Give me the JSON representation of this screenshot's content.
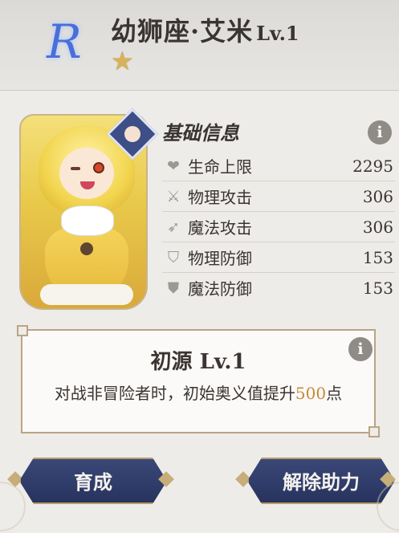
{
  "header": {
    "rarity": "R",
    "name": "幼狮座·艾米",
    "level": "Lv.1",
    "stars": "★"
  },
  "stats": {
    "title": "基础信息",
    "info_icon": "i",
    "rows": [
      {
        "icon": "heart-icon",
        "label": "生命上限",
        "value": "2295"
      },
      {
        "icon": "swords-icon",
        "label": "物理攻击",
        "value": "306"
      },
      {
        "icon": "magic-wand-icon",
        "label": "魔法攻击",
        "value": "306"
      },
      {
        "icon": "shield-icon",
        "label": "物理防御",
        "value": "153"
      },
      {
        "icon": "magic-shield-icon",
        "label": "魔法防御",
        "value": "153"
      }
    ]
  },
  "skill": {
    "title": "初源 Lv.1",
    "desc_prefix": "对战非冒险者时，初始奥义值提升",
    "desc_highlight": "500",
    "desc_suffix": "点",
    "info_icon": "i"
  },
  "buttons": {
    "train_label": "育成",
    "remove_label": "解除助力"
  },
  "colors": {
    "rarity": "#4a6fd8",
    "star": "#d8b25a",
    "highlight": "#c58a3a",
    "button": "#2f3b6a"
  }
}
